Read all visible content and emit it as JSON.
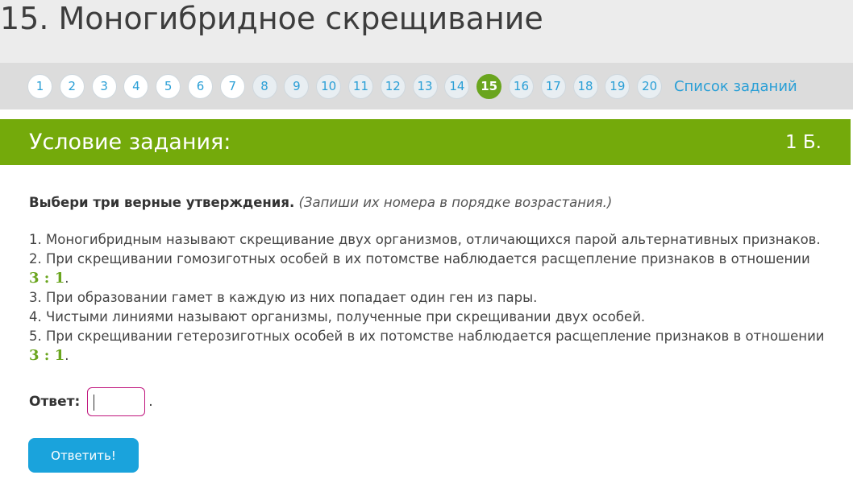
{
  "title": "15. Моногибридное скрещивание",
  "nav": {
    "numbers": [
      "1",
      "2",
      "3",
      "4",
      "5",
      "6",
      "7",
      "8",
      "9",
      "10",
      "11",
      "12",
      "13",
      "14",
      "15",
      "16",
      "17",
      "18",
      "19",
      "20"
    ],
    "current": "15",
    "list_link": "Список заданий"
  },
  "condition": {
    "title": "Условие задания:",
    "score": "1 Б."
  },
  "task": {
    "instruction_bold": "Выбери три верные утверждения.",
    "instruction_italic": "(Запиши их номера в порядке возрастания.)",
    "statements": [
      "1. Моногибридным называют скрещивание двух организмов, отличающихся парой альтернативных признаков.",
      "2. При скрещивании гомозиготных особей в их потомстве наблюдается расщепление признаков в отношении",
      "3. При образовании гамет в каждую из них попадает один ген из пары.",
      "4. Чистыми линиями называют организмы, полученные при скрещивании двух особей.",
      "5. При скрещивании гетерозиготных особей в их потомстве наблюдается расщепление признаков в отношении"
    ],
    "ratio": "3 : 1"
  },
  "answer": {
    "label": "Ответ:",
    "value": "",
    "suffix": "."
  },
  "submit_label": "Ответить!"
}
